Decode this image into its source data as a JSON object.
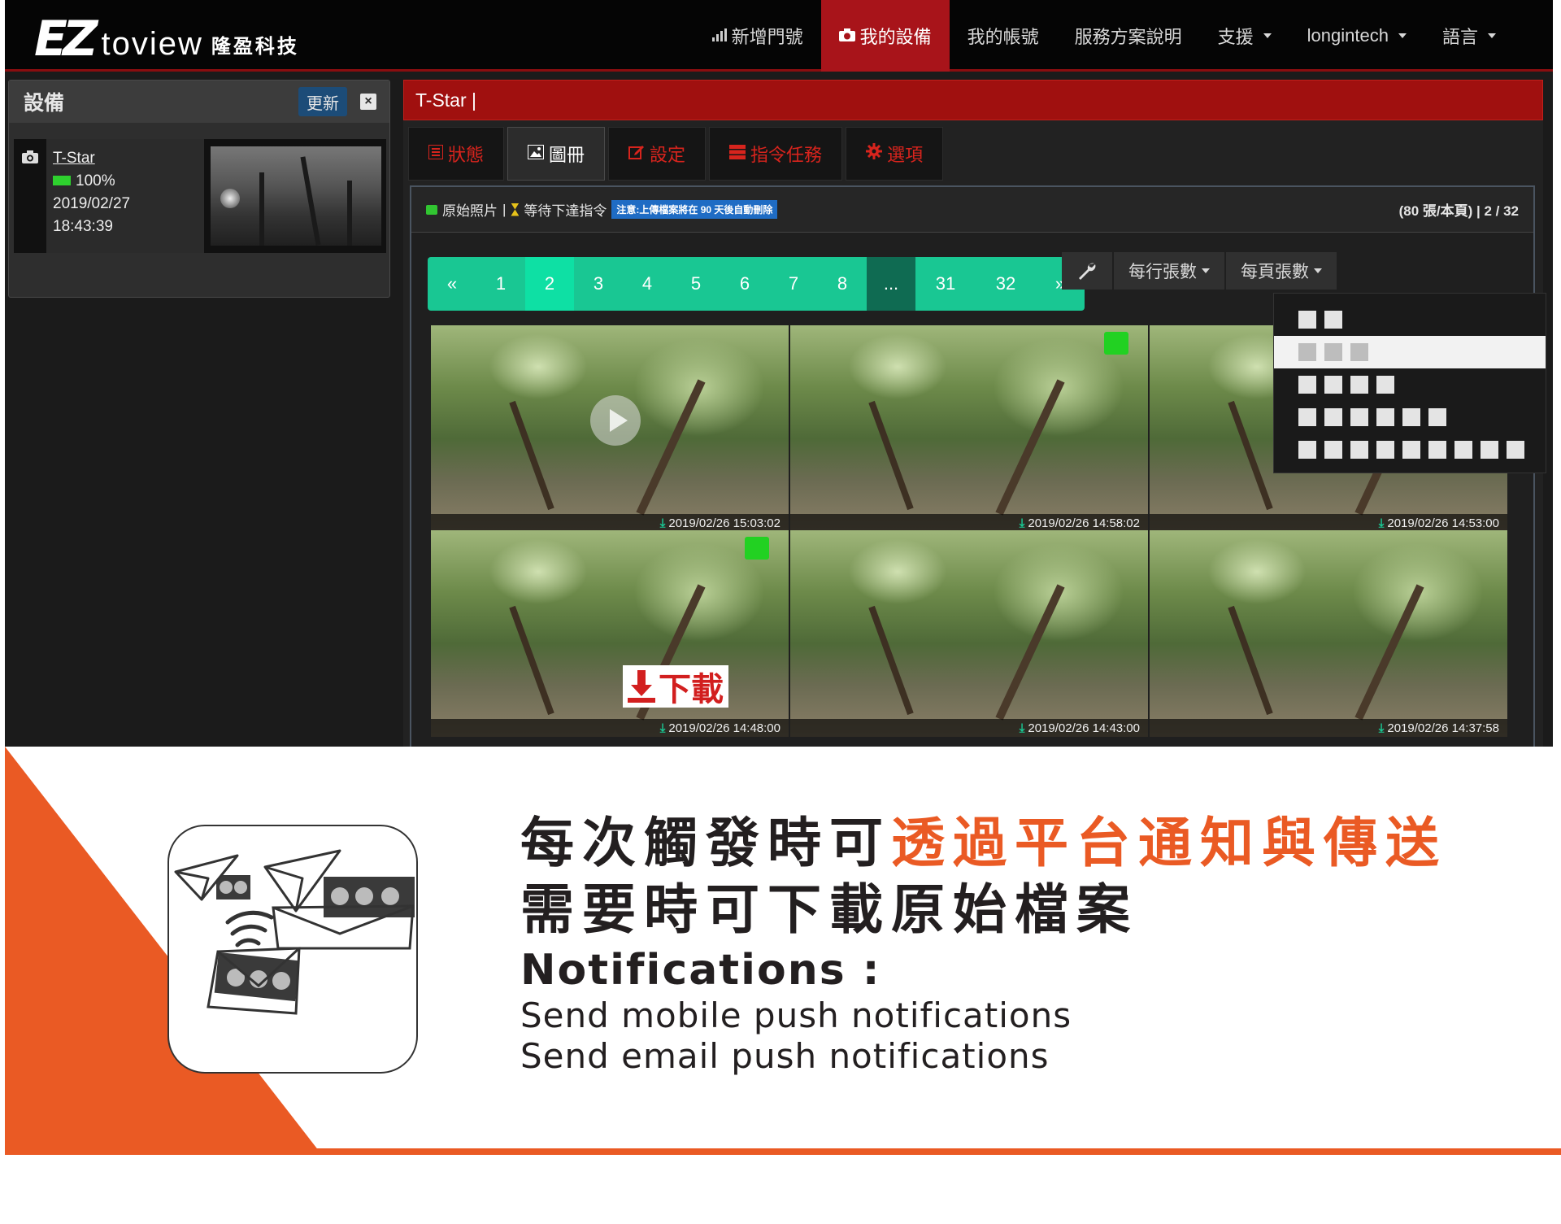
{
  "brand": {
    "logo_mark": "EZ",
    "logo_word": "toview",
    "logo_cn": "隆盈科技"
  },
  "navbar": {
    "items": [
      {
        "label": "新增門號",
        "icon": "signal-icon",
        "active": false,
        "dropdown": false
      },
      {
        "label": "我的設備",
        "icon": "camera-icon",
        "active": true,
        "dropdown": false
      },
      {
        "label": "我的帳號",
        "icon": "",
        "active": false,
        "dropdown": false
      },
      {
        "label": "服務方案說明",
        "icon": "",
        "active": false,
        "dropdown": false
      },
      {
        "label": "支援",
        "icon": "",
        "active": false,
        "dropdown": true
      },
      {
        "label": "longintech",
        "icon": "",
        "active": false,
        "dropdown": true
      },
      {
        "label": "語言",
        "icon": "",
        "active": false,
        "dropdown": true
      }
    ]
  },
  "device_panel": {
    "title": "設備",
    "refresh_label": "更新",
    "close_label": "×",
    "device": {
      "name": "T-Star",
      "battery": "100%",
      "date": "2019/02/27",
      "time": "18:43:39"
    }
  },
  "main": {
    "title": "T-Star |",
    "tabs": [
      {
        "label": "狀態",
        "icon": "list-icon",
        "active": false
      },
      {
        "label": "圖冊",
        "icon": "image-icon",
        "active": true
      },
      {
        "label": "設定",
        "icon": "edit-icon",
        "active": false
      },
      {
        "label": "指令任務",
        "icon": "server-icon",
        "active": false
      },
      {
        "label": "選項",
        "icon": "gear-icon",
        "active": false
      }
    ],
    "gallery_header": {
      "original_label": "原始照片",
      "separator": "|",
      "pending_label": "等待下達指令",
      "notice": "注意:上傳檔案將在 90 天後自動刪除",
      "page_count": "(80 張/本頁) | 2 / 32"
    },
    "pagination": [
      {
        "label": "«",
        "active": false
      },
      {
        "label": "1",
        "active": false
      },
      {
        "label": "2",
        "active": true
      },
      {
        "label": "3",
        "active": false
      },
      {
        "label": "4",
        "active": false
      },
      {
        "label": "5",
        "active": false
      },
      {
        "label": "6",
        "active": false
      },
      {
        "label": "7",
        "active": false
      },
      {
        "label": "8",
        "active": false
      },
      {
        "label": "...",
        "active": false
      },
      {
        "label": "31",
        "active": false
      },
      {
        "label": "32",
        "active": false
      },
      {
        "label": "»",
        "active": false
      }
    ],
    "toolbar": {
      "wrench_icon": "wrench-icon",
      "per_row_label": "每行張數",
      "per_page_label": "每頁張數"
    },
    "per_row_options": [
      2,
      3,
      4,
      6,
      9
    ],
    "per_row_selected": 3,
    "photos": [
      {
        "timestamp": "2019/02/26 15:03:02",
        "video": true,
        "badge": false,
        "download_overlay": false
      },
      {
        "timestamp": "2019/02/26 14:58:02",
        "video": false,
        "badge": true,
        "download_overlay": false
      },
      {
        "timestamp": "2019/02/26 14:53:00",
        "video": false,
        "badge": false,
        "download_overlay": false
      },
      {
        "timestamp": "2019/02/26 14:48:00",
        "video": false,
        "badge": true,
        "download_overlay": true
      },
      {
        "timestamp": "2019/02/26 14:43:00",
        "video": false,
        "badge": false,
        "download_overlay": false
      },
      {
        "timestamp": "2019/02/26 14:37:58",
        "video": false,
        "badge": false,
        "download_overlay": false
      }
    ],
    "download_overlay_label": "下載"
  },
  "banner": {
    "line1_plain": "每次觸發時可",
    "line1_highlight": "透過平台通知與傳送",
    "line2": "需要時可下載原始檔案",
    "en_heading": "Notifications :",
    "en_line1": "Send mobile push notifications",
    "en_line2": "Send email push notifications",
    "accent_color": "#ea5a24"
  }
}
